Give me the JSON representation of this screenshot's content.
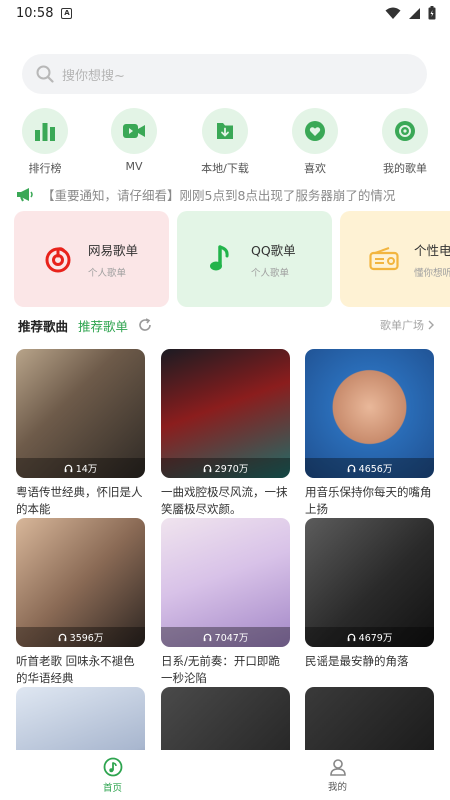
{
  "status_bar": {
    "time": "10:58",
    "notification_glyph": "A"
  },
  "search": {
    "placeholder": "搜你想搜~"
  },
  "quick_nav": [
    {
      "label": "排行榜",
      "icon": "bar-chart-icon"
    },
    {
      "label": "MV",
      "icon": "video-camera-icon"
    },
    {
      "label": "本地/下载",
      "icon": "download-icon"
    },
    {
      "label": "喜欢",
      "icon": "heart-icon"
    },
    {
      "label": "我的歌单",
      "icon": "disc-icon"
    }
  ],
  "notice": {
    "text": "【重要通知，请仔细看】刚刚5点到8点出现了服务器崩了的情况"
  },
  "cards": [
    {
      "title": "网易歌单",
      "subtitle": "个人歌单",
      "icon": "netease-music-icon",
      "bg": "#fbe6e7",
      "accent": "#e8221b"
    },
    {
      "title": "QQ歌单",
      "subtitle": "个人歌单",
      "icon": "qq-music-icon",
      "bg": "#e3f5e6",
      "accent": "#22b44b"
    },
    {
      "title": "个性电台",
      "subtitle": "懂你想听",
      "icon": "radio-icon",
      "bg": "#fef2d4",
      "accent": "#f2b53f"
    }
  ],
  "section": {
    "tab_active": "推荐歌曲",
    "tab_inactive": "推荐歌单",
    "more": "歌单广场"
  },
  "playlists": [
    {
      "title": "粤语传世经典，怀旧是人的本能",
      "plays": "14万",
      "gradient": "linear-gradient(135deg,#b8a48a 0%,#6e5b4a 40%,#2f2a25 100%)"
    },
    {
      "title": "一曲戏腔极尽风流，一抹笑靥极尽欢颜。",
      "plays": "2970万",
      "gradient": "linear-gradient(160deg,#1b1b22 0%,#8b1d1d 45%,#1d6e6a 100%)"
    },
    {
      "title": "用音乐保持你每天的嘴角上扬",
      "plays": "4656万",
      "gradient": "radial-gradient(circle at 50% 45%,#e9b89a 0%,#c88b6c 38%,#2a6db8 39%,#1f4f8f 100%)"
    },
    {
      "title": "听首老歌 回味永不褪色的华语经典",
      "plays": "3596万",
      "gradient": "linear-gradient(135deg,#d8b79a 0%,#8a6a55 50%,#2e2622 100%)"
    },
    {
      "title": "日系/无前奏：开口即跪一秒沦陷",
      "plays": "7047万",
      "gradient": "linear-gradient(160deg,#f0e4ee 0%,#d8c2e8 45%,#a387c7 100%)"
    },
    {
      "title": "民谣是最安静的角落",
      "plays": "4679万",
      "gradient": "linear-gradient(135deg,#5c5c5c 0%,#2a2a2a 55%,#111 100%)"
    },
    {
      "title": "",
      "plays": "",
      "gradient": "linear-gradient(160deg,#dfe7f2 0%,#a9b7cf 60%,#3c3f52 100%)"
    },
    {
      "title": "",
      "plays": "",
      "gradient": "linear-gradient(135deg,#4a4a4a 0%,#1c1c1c 100%)"
    },
    {
      "title": "",
      "plays": "",
      "gradient": "linear-gradient(135deg,#3a3a3a 0%,#111 100%)"
    }
  ],
  "bottom_nav": [
    {
      "label": "首页",
      "active": true
    },
    {
      "label": "我的",
      "active": false
    }
  ],
  "colors": {
    "accent": "#2ea44f",
    "muted": "#a5a5a5"
  }
}
